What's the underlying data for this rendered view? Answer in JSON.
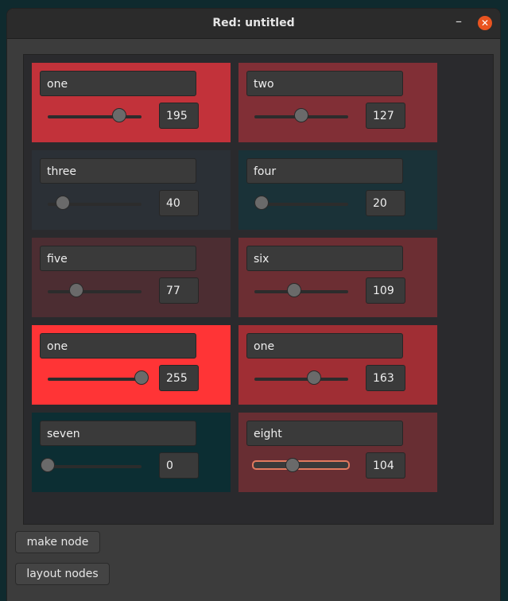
{
  "window": {
    "title": "Red: untitled",
    "minimize_glyph": "–",
    "close_glyph": "✕"
  },
  "nodes": [
    {
      "name": "one",
      "value": "195",
      "level": 195,
      "color": "#c2323a"
    },
    {
      "name": "two",
      "value": "127",
      "level": 127,
      "color": "#812f36"
    },
    {
      "name": "three",
      "value": "40",
      "level": 40,
      "color": "#2b3036"
    },
    {
      "name": "four",
      "value": "20",
      "level": 20,
      "color": "#1a3238"
    },
    {
      "name": "five",
      "value": "77",
      "level": 77,
      "color": "#4c2d32"
    },
    {
      "name": "six",
      "value": "109",
      "level": 109,
      "color": "#6c2e33"
    },
    {
      "name": "one",
      "value": "255",
      "level": 255,
      "color": "#ff3436"
    },
    {
      "name": "one",
      "value": "163",
      "level": 163,
      "color": "#a02e34"
    },
    {
      "name": "seven",
      "value": "0",
      "level": 0,
      "color": "#0c2e33"
    },
    {
      "name": "eight",
      "value": "104",
      "level": 104,
      "color": "#682e33"
    }
  ],
  "buttons": {
    "make_node": "make node",
    "layout_nodes": "layout nodes"
  }
}
